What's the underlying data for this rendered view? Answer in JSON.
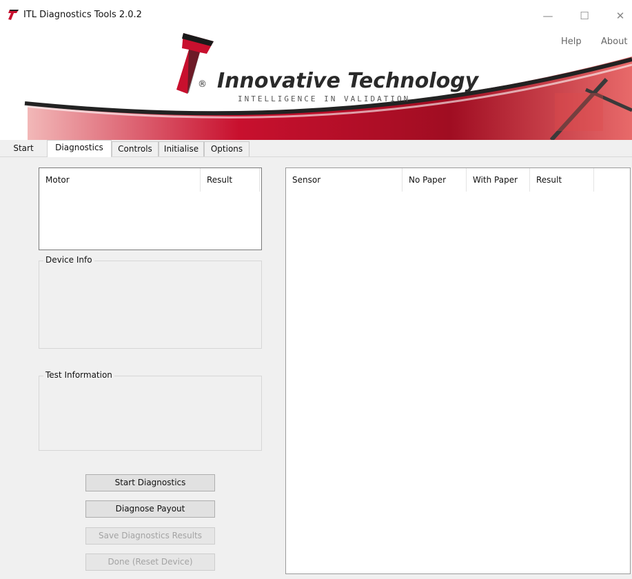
{
  "window": {
    "title": "ITL Diagnostics Tools 2.0.2",
    "controls": {
      "minimize": "—",
      "maximize": "☐",
      "close": "✕"
    }
  },
  "header": {
    "menu": [
      {
        "label": "Help"
      },
      {
        "label": "About"
      }
    ],
    "brand_name": "Innovative Technology",
    "brand_tagline": "INTELLIGENCE IN VALIDATION",
    "logo_icon": "itl-logo-icon",
    "colors": {
      "brand_red": "#c8102e",
      "brand_dark": "#2a2a2a"
    }
  },
  "tabs": [
    {
      "label": "Start",
      "active": false
    },
    {
      "label": "Diagnostics",
      "active": true
    },
    {
      "label": "Controls",
      "active": false
    },
    {
      "label": "Initialise",
      "active": false
    },
    {
      "label": "Options",
      "active": false
    }
  ],
  "motor_table": {
    "columns": [
      "Motor",
      "Result"
    ],
    "rows": []
  },
  "sensor_table": {
    "columns": [
      "Sensor",
      "No Paper",
      "With Paper",
      "Result"
    ],
    "rows": []
  },
  "device_info": {
    "label": "Device Info"
  },
  "test_info": {
    "label": "Test Information"
  },
  "buttons": {
    "start": "Start Diagnostics",
    "payout": "Diagnose Payout",
    "save": "Save Diagnostics Results",
    "done": "Done (Reset Device)"
  }
}
